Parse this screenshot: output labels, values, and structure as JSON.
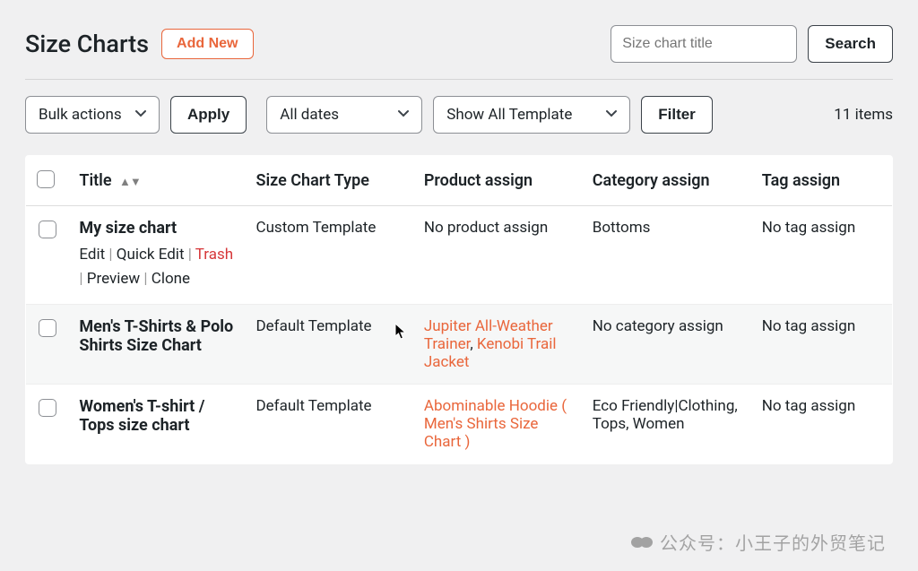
{
  "header": {
    "title": "Size Charts",
    "add_new": "Add New",
    "search_placeholder": "Size chart title",
    "search_button": "Search"
  },
  "toolbar": {
    "bulk_actions": "Bulk actions",
    "apply": "Apply",
    "all_dates": "All dates",
    "show_all_template": "Show All Template",
    "filter": "Filter",
    "items_count": "11 items"
  },
  "columns": {
    "title": "Title",
    "type": "Size Chart Type",
    "product": "Product assign",
    "category": "Category assign",
    "tag": "Tag assign"
  },
  "row_actions": {
    "edit": "Edit",
    "quick_edit": "Quick Edit",
    "trash": "Trash",
    "preview": "Preview",
    "clone": "Clone"
  },
  "rows": [
    {
      "title": "My size chart",
      "type": "Custom Template",
      "products_raw": "No product assign",
      "products_links": [],
      "category": "Bottoms",
      "tag": "No tag assign",
      "show_actions": true
    },
    {
      "title": "Men's T-Shirts & Polo Shirts Size Chart",
      "type": "Default Template",
      "products_raw": "",
      "products_links": [
        "Jupiter All-Weather Trainer",
        "Kenobi Trail Jacket"
      ],
      "category": "No category assign",
      "tag": "No tag assign",
      "show_actions": false
    },
    {
      "title": "Women's T-shirt / Tops size chart",
      "type": "Default Template",
      "products_raw": "",
      "products_links": [
        "Abominable Hoodie ( Men's Shirts Size Chart )"
      ],
      "category": "Eco Friendly|Clothing, Tops, Women",
      "tag": "No tag assign",
      "show_actions": false
    }
  ],
  "watermark": "公众号：小王子的外贸笔记"
}
